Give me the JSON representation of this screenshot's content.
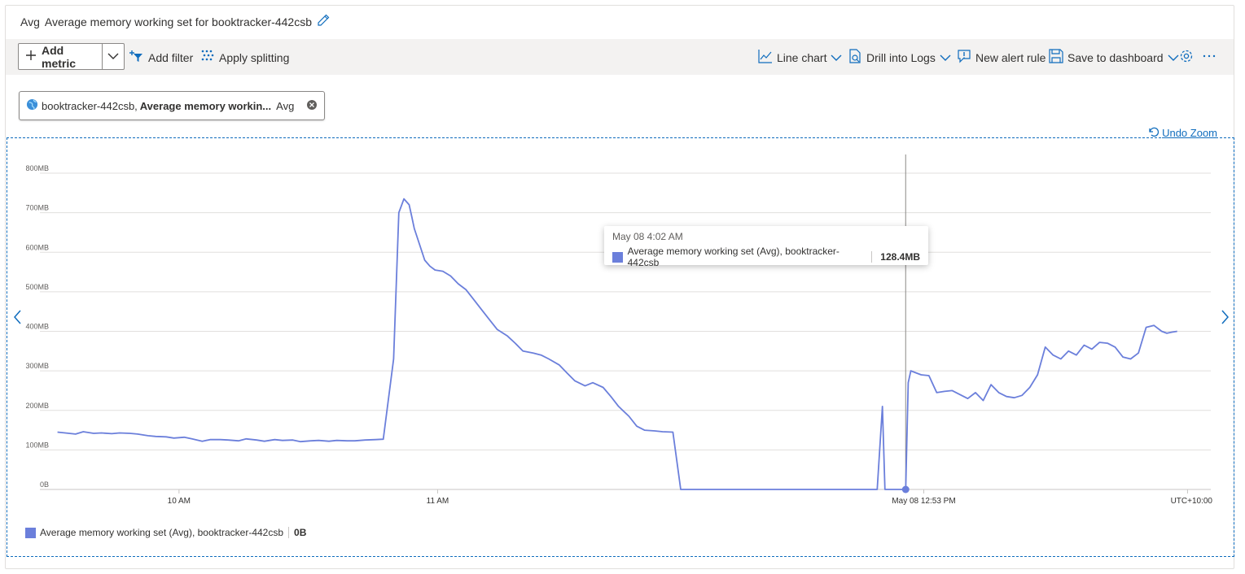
{
  "title": {
    "prefix": "Avg",
    "text": "Average memory working set for booktracker-442csb"
  },
  "toolbar": {
    "add_metric": "Add metric",
    "add_filter": "Add filter",
    "apply_splitting": "Apply splitting",
    "line_chart": "Line chart",
    "drill_into_logs": "Drill into Logs",
    "new_alert_rule": "New alert rule",
    "save_to_dashboard": "Save to dashboard"
  },
  "metric_chip": {
    "resource": "booktracker-442csb,",
    "metric": "Average memory workin...",
    "aggregation": "Avg"
  },
  "undo_zoom": "Undo Zoom",
  "tooltip": {
    "time": "May 08 4:02 AM",
    "label": "Average memory working set (Avg), booktracker-442csb",
    "value": "128.4MB"
  },
  "legend": {
    "label": "Average memory working set (Avg), booktracker-442csb",
    "value": "0B"
  },
  "colors": {
    "series": "#6b7fdb",
    "accent": "#0f6cbd"
  },
  "chart_data": {
    "type": "line",
    "y_ticks": [
      "0B",
      "100MB",
      "200MB",
      "300MB",
      "400MB",
      "500MB",
      "600MB",
      "700MB",
      "800MB"
    ],
    "ylim": [
      0,
      800
    ],
    "x_ticks": [
      {
        "label": "10 AM",
        "t": 10.0
      },
      {
        "label": "11 AM",
        "t": 11.0
      },
      {
        "label": "May 08 12:53 PM",
        "t": 12.88
      },
      {
        "label": "UTC+10:00",
        "t": 13.9
      }
    ],
    "xlim": [
      9.525,
      13.99
    ],
    "grid": true,
    "cursor_t": 12.81,
    "series": [
      {
        "name": "Average memory working set (Avg), booktracker-442csb",
        "x": [
          9.53,
          9.56,
          9.6,
          9.63,
          9.67,
          9.7,
          9.74,
          9.77,
          9.81,
          9.84,
          9.88,
          9.91,
          9.95,
          9.98,
          10.02,
          10.05,
          10.09,
          10.12,
          10.16,
          10.19,
          10.23,
          10.26,
          10.3,
          10.33,
          10.37,
          10.4,
          10.44,
          10.47,
          10.51,
          10.54,
          10.58,
          10.61,
          10.65,
          10.68,
          10.72,
          10.76,
          10.79,
          10.83,
          10.85,
          10.87,
          10.89,
          10.9,
          10.91,
          10.93,
          10.95,
          10.97,
          10.99,
          11.02,
          11.05,
          11.08,
          11.11,
          11.14,
          11.17,
          11.2,
          11.23,
          11.27,
          11.3,
          11.33,
          11.37,
          11.4,
          11.43,
          11.47,
          11.5,
          11.53,
          11.57,
          11.6,
          11.64,
          11.67,
          11.7,
          11.74,
          11.77,
          11.8,
          11.84,
          11.87,
          11.91,
          11.94,
          11.97,
          12.01,
          12.04,
          12.07,
          12.1,
          12.13,
          12.16,
          12.19,
          12.2,
          12.3,
          12.4,
          12.5,
          12.6,
          12.7,
          12.72,
          12.73,
          12.74,
          12.76,
          12.79,
          12.81,
          12.82,
          12.83,
          12.85,
          12.87,
          12.9,
          12.93,
          12.96,
          12.99,
          13.02,
          13.05,
          13.08,
          13.11,
          13.14,
          13.17,
          13.2,
          13.23,
          13.26,
          13.29,
          13.32,
          13.35,
          13.38,
          13.41,
          13.44,
          13.47,
          13.5,
          13.53,
          13.56,
          13.59,
          13.62,
          13.65,
          13.68,
          13.71,
          13.74,
          13.77,
          13.8,
          13.82,
          13.84,
          13.86
        ],
        "values": [
          145,
          143,
          140,
          146,
          142,
          143,
          141,
          143,
          142,
          140,
          136,
          134,
          133,
          130,
          132,
          128,
          122,
          126,
          126,
          125,
          123,
          128,
          125,
          122,
          126,
          124,
          125,
          121,
          123,
          124,
          122,
          124,
          123,
          123,
          125,
          126,
          127,
          330,
          700,
          735,
          720,
          690,
          660,
          620,
          580,
          565,
          555,
          552,
          540,
          520,
          505,
          480,
          455,
          430,
          405,
          388,
          370,
          350,
          345,
          340,
          330,
          315,
          295,
          275,
          262,
          270,
          258,
          235,
          210,
          185,
          160,
          150,
          148,
          146,
          145,
          0,
          0,
          0,
          0,
          0,
          0,
          0,
          0,
          0,
          0,
          0,
          0,
          0,
          0,
          0,
          210,
          0,
          0,
          0,
          0,
          0,
          270,
          300,
          295,
          290,
          288,
          245,
          248,
          250,
          240,
          230,
          245,
          225,
          265,
          245,
          235,
          232,
          238,
          258,
          290,
          360,
          340,
          330,
          350,
          340,
          365,
          355,
          372,
          370,
          360,
          335,
          330,
          345,
          410,
          415,
          400,
          395,
          398,
          400
        ]
      }
    ]
  }
}
